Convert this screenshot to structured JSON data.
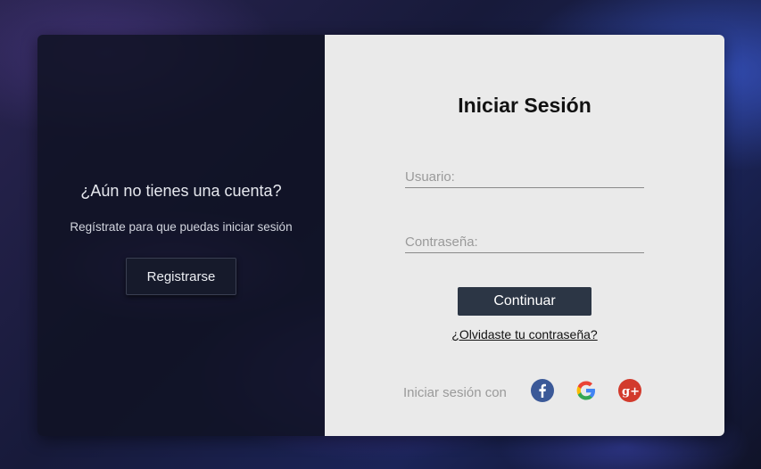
{
  "left_panel": {
    "title": "¿Aún no tienes una cuenta?",
    "subtitle": "Regístrate para que puedas iniciar sesión",
    "register_label": "Registrarse"
  },
  "login": {
    "title": "Iniciar Sesión",
    "username_placeholder": "Usuario:",
    "password_placeholder": "Contraseña:",
    "continue_label": "Continuar",
    "forgot_link": "¿Olvidaste tu contraseña?",
    "social_label": "Iniciar sesión con"
  },
  "social_icons": [
    "facebook-icon",
    "google-icon",
    "google-plus-icon"
  ],
  "colors": {
    "button_dark": "#2c3645",
    "panel_light": "#eaeaea",
    "panel_dark": "#101324",
    "facebook": "#3b5998",
    "google_plus": "#d23a2c"
  }
}
